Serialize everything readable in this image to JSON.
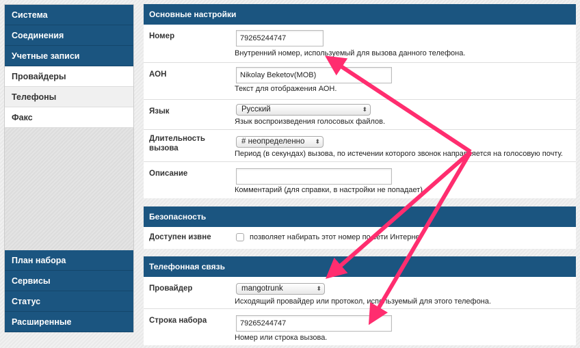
{
  "sidebar": {
    "top": [
      "Система",
      "Соединения",
      "Учетные записи"
    ],
    "sub": [
      "Провайдеры",
      "Телефоны",
      "Факс"
    ],
    "bottom": [
      "План набора",
      "Сервисы",
      "Статус",
      "Расширенные"
    ]
  },
  "basic": {
    "title": "Основные настройки",
    "number": {
      "label": "Номер",
      "value": "79265244747",
      "hint": "Внутренний номер, используемый для вызова данного телефона."
    },
    "cid": {
      "label": "АОН",
      "value": "Nikolay Beketov(MOB)",
      "hint": "Текст для отображения АОН."
    },
    "lang": {
      "label": "Язык",
      "value": "Русский",
      "hint": "Язык воспроизведения голосовых файлов."
    },
    "duration": {
      "label": "Длительность вызова",
      "value": "# неопределенно",
      "hint": "Период (в секундах) вызова, по истечении которого звонок направляется на голосовую почту."
    },
    "desc": {
      "label": "Описание",
      "value": "",
      "hint": "Комментарий (для справки, в настройки не попадает)"
    }
  },
  "security": {
    "title": "Безопасность",
    "external": {
      "label": "Доступен извне",
      "hint": "позволяет набирать этот номер по сети Интернет"
    }
  },
  "telephony": {
    "title": "Телефонная связь",
    "provider": {
      "label": "Провайдер",
      "value": "mangotrunk",
      "hint": "Исходящий провайдер или протокол, используемый для этого телефона."
    },
    "dialstring": {
      "label": "Строка набора",
      "value": "79265244747",
      "hint": "Номер или строка вызова."
    }
  },
  "colors": {
    "accent": "#1b5580",
    "arrow": "#ff2d6f"
  }
}
